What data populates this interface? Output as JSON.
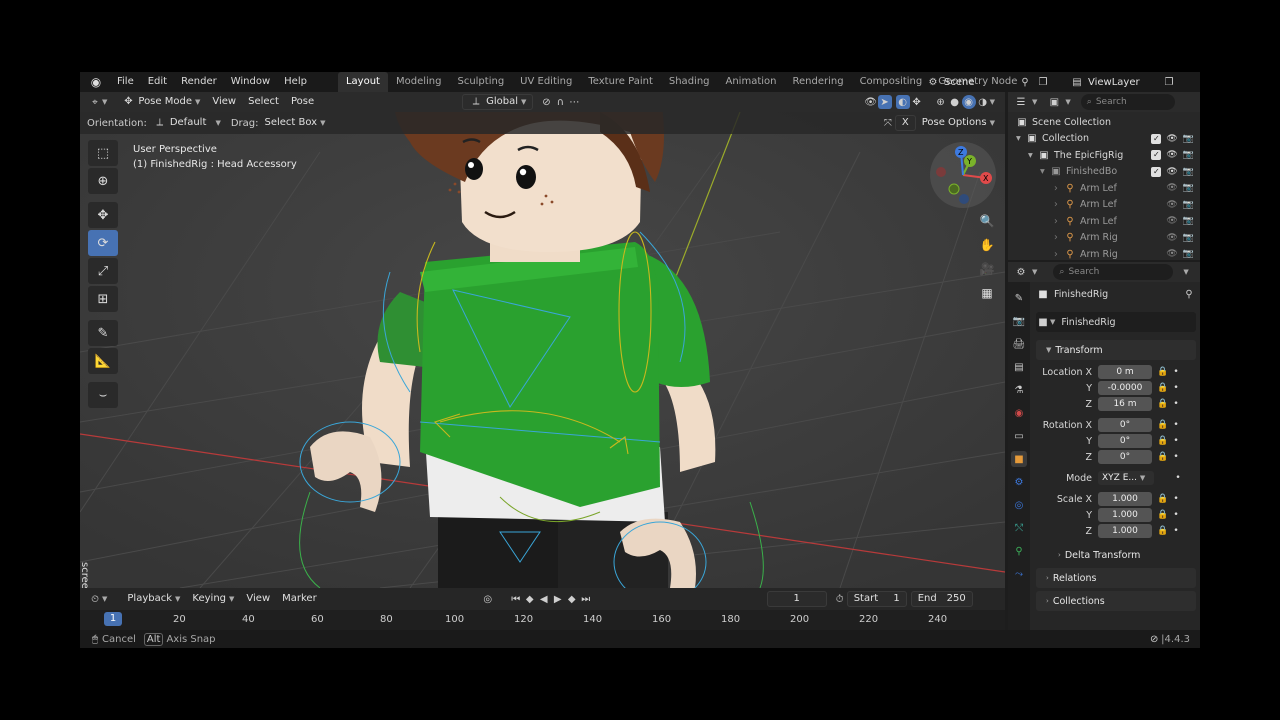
{
  "menu": {
    "file": "File",
    "edit": "Edit",
    "render": "Render",
    "window": "Window",
    "help": "Help"
  },
  "workspaces": [
    "Layout",
    "Modeling",
    "Sculpting",
    "UV Editing",
    "Texture Paint",
    "Shading",
    "Animation",
    "Rendering",
    "Compositing",
    "Geometry Node"
  ],
  "scene": {
    "name": "Scene"
  },
  "view_layer": {
    "name": "ViewLayer"
  },
  "viewport_header": {
    "mode": "Pose Mode",
    "view": "View",
    "select": "Select",
    "pose": "Pose",
    "transform_orientation": "Global",
    "orientation_label": "Orientation:",
    "orientation_value": "Default",
    "drag_label": "Drag:",
    "drag_value": "Select Box",
    "pose_options": "Pose Options",
    "x_label": "X"
  },
  "viewport_info": {
    "line1": "User Perspective",
    "line2": "(1) FinishedRig : Head Accessory"
  },
  "timeline": {
    "playback": "Playback",
    "keying": "Keying",
    "view": "View",
    "marker": "Marker",
    "current_frame": "1",
    "start_label": "Start",
    "start_value": "1",
    "end_label": "End",
    "end_value": "250",
    "ruler_current": "1",
    "ruler": [
      "20",
      "40",
      "60",
      "80",
      "100",
      "120",
      "140",
      "160",
      "180",
      "200",
      "220",
      "240"
    ]
  },
  "statusbar": {
    "cancel": "Cancel",
    "alt_key": "Alt",
    "axis_snap": "Axis Snap",
    "version": "4.4.3"
  },
  "outliner": {
    "search_placeholder": "Search",
    "scene_collection": "Scene Collection",
    "rows": [
      {
        "label": "Collection"
      },
      {
        "label": "The EpicFigRig"
      },
      {
        "label": "FinishedBo"
      },
      {
        "label": "Arm Lef"
      },
      {
        "label": "Arm Lef"
      },
      {
        "label": "Arm Lef"
      },
      {
        "label": "Arm Rig"
      },
      {
        "label": "Arm Rig"
      }
    ]
  },
  "properties": {
    "search_placeholder": "Search",
    "object_name": "FinishedRig",
    "data_name": "FinishedRig",
    "transform_header": "Transform",
    "location": {
      "label_x": "Location X",
      "label_y": "Y",
      "label_z": "Z",
      "x": "0 m",
      "y": "-0.0000",
      "z": "16 m"
    },
    "rotation": {
      "label_x": "Rotation X",
      "label_y": "Y",
      "label_z": "Z",
      "x": "0°",
      "y": "0°",
      "z": "0°"
    },
    "mode": {
      "label": "Mode",
      "value": "XYZ E..."
    },
    "scale": {
      "label_x": "Scale X",
      "label_y": "Y",
      "label_z": "Z",
      "x": "1.000",
      "y": "1.000",
      "z": "1.000"
    },
    "delta_transform": "Delta Transform",
    "relations": "Relations",
    "collections": "Collections"
  },
  "watermark": {
    "text": "screenrec"
  },
  "colors": {
    "accent": "#4772b3",
    "viewport_bg": "#3d3d3d",
    "shirt": "#2aa12f",
    "skin": "#f0dcc8",
    "hair": "#6b3a20"
  }
}
